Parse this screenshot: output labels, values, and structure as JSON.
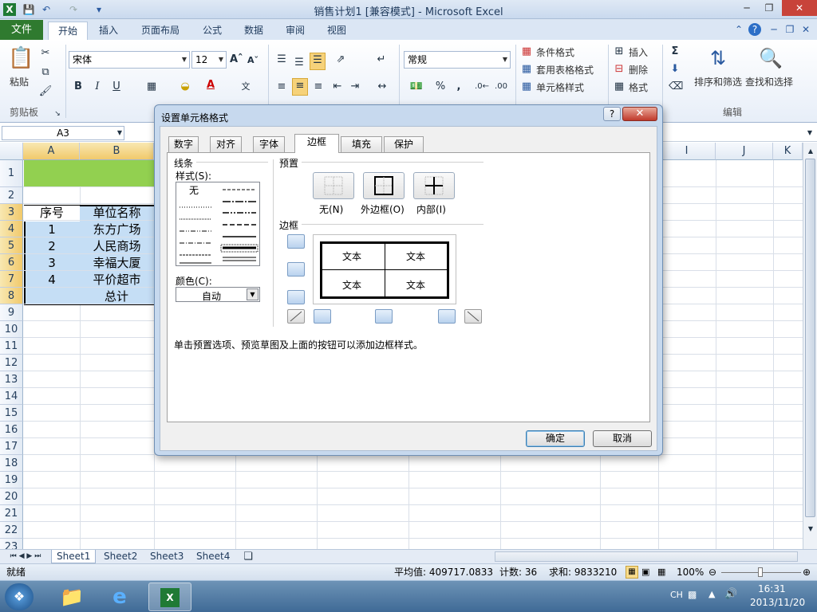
{
  "window": {
    "title": "销售计划1 [兼容模式] - Microsoft Excel"
  },
  "ribbon": {
    "tabs": [
      "文件",
      "开始",
      "插入",
      "页面布局",
      "公式",
      "数据",
      "审阅",
      "视图"
    ],
    "active_tab": "开始",
    "clipboard": {
      "paste": "粘贴",
      "group": "剪贴板"
    },
    "font": {
      "name": "宋体",
      "size": "12",
      "bold": "B",
      "italic": "I",
      "underline": "U"
    },
    "number": {
      "format": "常规",
      "percent": "%",
      "comma": ","
    },
    "styles": {
      "conditional": "条件格式",
      "table": "套用表格格式",
      "cell": "单元格样式"
    },
    "cells": {
      "insert": "插入",
      "delete": "删除",
      "format": "格式"
    },
    "editing": {
      "sort": "排序和筛选",
      "find": "查找和选择",
      "group": "编辑",
      "sigma": "Σ"
    }
  },
  "formula_bar": {
    "name_box": "A3"
  },
  "grid": {
    "columns": [
      "A",
      "B",
      "I",
      "J",
      "K"
    ],
    "rows": [
      "1",
      "2",
      "3",
      "4",
      "5",
      "6",
      "7",
      "8",
      "9",
      "10",
      "11",
      "12",
      "13",
      "14",
      "15",
      "16",
      "17",
      "18",
      "19",
      "20",
      "21",
      "22",
      "23"
    ],
    "cells": {
      "a3": "序号",
      "b3": "单位名称",
      "a4": "1",
      "b4": "东方广场",
      "a5": "2",
      "b5": "人民商场",
      "a6": "3",
      "b6": "幸福大厦",
      "a7": "4",
      "b7": "平价超市",
      "b8": "总计"
    }
  },
  "sheets": {
    "tabs": [
      "Sheet1",
      "Sheet2",
      "Sheet3",
      "Sheet4"
    ],
    "active": "Sheet1"
  },
  "status": {
    "mode": "就绪",
    "average": "平均值: 409717.0833",
    "count": "计数: 36",
    "sum": "求和: 9833210",
    "zoom": "100%"
  },
  "taskbar": {
    "ime": "CH",
    "time": "16:31",
    "date": "2013/11/20"
  },
  "dialog": {
    "title": "设置单元格格式",
    "help": "?",
    "tabs": [
      "数字",
      "对齐",
      "字体",
      "边框",
      "填充",
      "保护"
    ],
    "active_tab": "边框",
    "line_group": "线条",
    "style_label": "样式(S):",
    "style_none": "无",
    "color_label": "颜色(C):",
    "color_value": "自动",
    "presets_group": "预置",
    "presets": [
      "无(N)",
      "外边框(O)",
      "内部(I)"
    ],
    "border_group": "边框",
    "preview_text": "文本",
    "hint": "单击预置选项、预览草图及上面的按钮可以添加边框样式。",
    "ok": "确定",
    "cancel": "取消"
  },
  "colors": {
    "title_green": "#92d050",
    "table_blue": "#c5def5",
    "file_tab": "#2f7a2f"
  }
}
